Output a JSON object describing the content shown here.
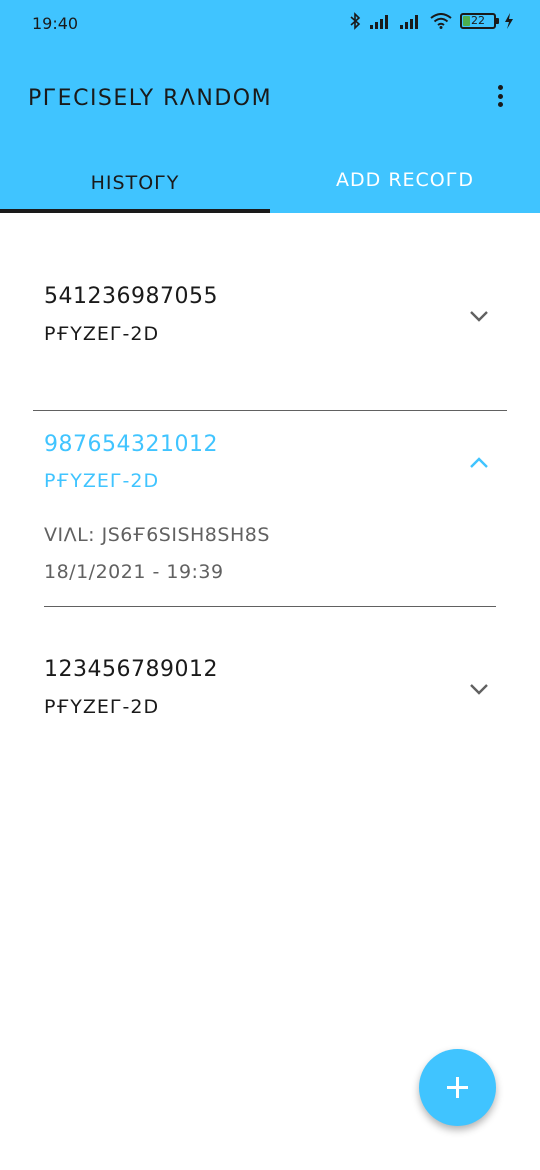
{
  "status_bar": {
    "time": "19:40",
    "battery_percent": "22",
    "icons": [
      "bluetooth-icon",
      "signal-icon",
      "signal-icon",
      "wifi-icon",
      "battery-icon",
      "charging-icon"
    ]
  },
  "app_bar": {
    "title": "PГECISELY RΛNDOM",
    "menu_icon": "more-vert-icon"
  },
  "tabs": [
    {
      "label": "HISTOГY",
      "active": true
    },
    {
      "label": "ADD RECOГD",
      "active": false
    }
  ],
  "records": [
    {
      "code": "541236987055",
      "product": "PҒYZEГ-2D",
      "expanded": false,
      "chevron": "chevron-down-icon"
    },
    {
      "code": "987654321012",
      "product": "PҒYZEГ-2D",
      "expanded": true,
      "chevron": "chevron-up-icon",
      "vial": "VIΛL: JS6Ғ6SISH8SH8S",
      "datetime": "18/1/2021 - 19:39"
    },
    {
      "code": "123456789012",
      "product": "PҒYZEГ-2D",
      "expanded": false,
      "chevron": "chevron-down-icon"
    }
  ],
  "fab": {
    "icon": "plus-icon"
  },
  "colors": {
    "primary": "#40c4ff",
    "text": "#1a1a1a",
    "secondary_text": "#616161"
  }
}
